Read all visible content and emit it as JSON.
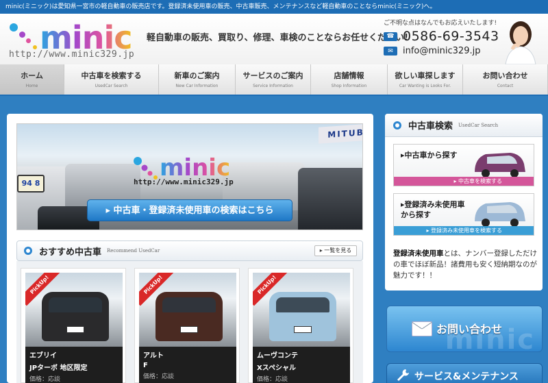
{
  "topbar": {
    "text": "minic(ミニック)は愛知県一宮市の軽自動車の販売店です。登録済未使用車の販売、中古車販売、メンテナンスなど軽自動車のことならminic(ミニック)へ。"
  },
  "header": {
    "logo_text": "minic",
    "logo_url": "http://www.minic329.jp",
    "tagline": "軽自動車の販売、買取り、修理、車検のことならお任せください!",
    "contact_note": "ご不明な点はなんでもお応えいたします!",
    "phone": "0586-69-3543",
    "email": "info@minic329.jp"
  },
  "nav": [
    {
      "jp": "ホーム",
      "en": "Home",
      "width": 94
    },
    {
      "jp": "中古車を検索する",
      "en": "UsedCar Search",
      "width": 138
    },
    {
      "jp": "新車のご案内",
      "en": "New Car Information",
      "width": 112
    },
    {
      "jp": "サービスのご案内",
      "en": "Service Information",
      "width": 110
    },
    {
      "jp": "店舗情報",
      "en": "Shop Information",
      "width": 112
    },
    {
      "jp": "欲しい車探します",
      "en": "Car Wanting is Looks For.",
      "width": 110
    },
    {
      "jp": "お問い合わせ",
      "en": "Contact",
      "width": 124
    }
  ],
  "banner": {
    "logo_text": "minic",
    "url": "http://www.minic329.jp",
    "button_label": "中古車・登録済未使用車の検索はこちら",
    "sign_text": "MITUB",
    "plate_text": "94 8"
  },
  "recommend": {
    "title": "おすすめ中古車",
    "en": "Recommend UsedCar",
    "more_label": "一覧を見る",
    "pickup_label": "PickUp!",
    "cards": [
      {
        "name": "エブリイ",
        "sub": "JPターボ 地区限定",
        "price": "価格：応談",
        "color": "#2a2a2c"
      },
      {
        "name": "アルト",
        "sub": "F",
        "price": "価格：応談",
        "color": "#4a2a22"
      },
      {
        "name": "ムーヴコンテ",
        "sub": "Xスペシャル",
        "price": "価格：応談",
        "color": "#9fc3dc"
      }
    ]
  },
  "side": {
    "title": "中古車検索",
    "en": "UsedCar Search",
    "boxes": [
      {
        "label": "中古車から探す",
        "bar": "中古車を検索する",
        "bar_color": "#d4569a",
        "car_color": "#7a3d6e"
      },
      {
        "label": "登録済み未使用車\nから探す",
        "bar": "登録済み未使用車を検索する",
        "bar_color": "#3a9ed6",
        "car_color": "#9db9d6"
      }
    ],
    "desc_bold": "登録済未使用車",
    "desc_rest": "とは、ナンバー登録しただけの車でほぼ新品！諸費用も安く短納期なのが魅力です！！"
  },
  "contact_button": {
    "label": "お問い合わせ",
    "watermark": "minic"
  },
  "service_button": {
    "label": "サービス&メンテナンス"
  }
}
